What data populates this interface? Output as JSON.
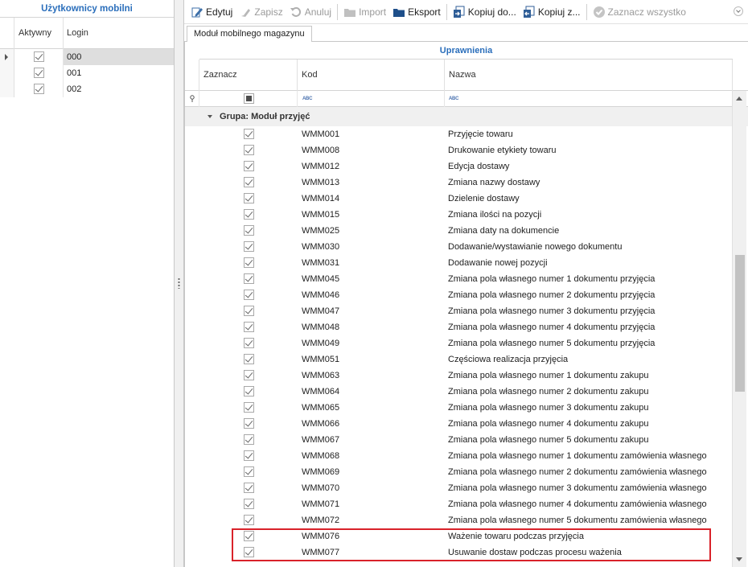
{
  "left_panel": {
    "title": "Użytkownicy mobilni",
    "columns": {
      "active": "Aktywny",
      "login": "Login"
    },
    "rows": [
      {
        "active": true,
        "login": "000",
        "selected": true
      },
      {
        "active": true,
        "login": "001",
        "selected": false
      },
      {
        "active": true,
        "login": "002",
        "selected": false
      }
    ]
  },
  "toolbar": {
    "edit": "Edytuj",
    "save": "Zapisz",
    "cancel": "Anuluj",
    "import": "Import",
    "export": "Eksport",
    "copy_to": "Kopiuj do...",
    "copy_from": "Kopiuj z...",
    "select_all": "Zaznacz wszystko"
  },
  "tab": {
    "label": "Moduł mobilnego magazynu"
  },
  "grid": {
    "band_title": "Uprawnienia",
    "columns": {
      "select": "Zaznacz",
      "code": "Kod",
      "name": "Nazwa"
    },
    "group_label": "Grupa: Moduł przyjęć",
    "rows": [
      {
        "checked": true,
        "code": "WMM001",
        "name": "Przyjęcie towaru"
      },
      {
        "checked": true,
        "code": "WMM008",
        "name": "Drukowanie etykiety towaru"
      },
      {
        "checked": true,
        "code": "WMM012",
        "name": "Edycja dostawy"
      },
      {
        "checked": true,
        "code": "WMM013",
        "name": "Zmiana nazwy dostawy"
      },
      {
        "checked": true,
        "code": "WMM014",
        "name": "Dzielenie dostawy"
      },
      {
        "checked": true,
        "code": "WMM015",
        "name": "Zmiana ilości na pozycji"
      },
      {
        "checked": true,
        "code": "WMM025",
        "name": "Zmiana daty na dokumencie"
      },
      {
        "checked": true,
        "code": "WMM030",
        "name": "Dodawanie/wystawianie nowego dokumentu"
      },
      {
        "checked": true,
        "code": "WMM031",
        "name": "Dodawanie nowej pozycji"
      },
      {
        "checked": true,
        "code": "WMM045",
        "name": "Zmiana pola własnego numer 1 dokumentu przyjęcia"
      },
      {
        "checked": true,
        "code": "WMM046",
        "name": "Zmiana pola własnego numer 2 dokumentu przyjęcia"
      },
      {
        "checked": true,
        "code": "WMM047",
        "name": "Zmiana pola własnego numer 3 dokumentu przyjęcia"
      },
      {
        "checked": true,
        "code": "WMM048",
        "name": "Zmiana pola własnego numer 4 dokumentu przyjęcia"
      },
      {
        "checked": true,
        "code": "WMM049",
        "name": "Zmiana pola własnego numer 5 dokumentu przyjęcia"
      },
      {
        "checked": true,
        "code": "WMM051",
        "name": "Częściowa realizacja przyjęcia"
      },
      {
        "checked": true,
        "code": "WMM063",
        "name": "Zmiana pola własnego numer 1 dokumentu zakupu"
      },
      {
        "checked": true,
        "code": "WMM064",
        "name": "Zmiana pola własnego numer 2 dokumentu zakupu"
      },
      {
        "checked": true,
        "code": "WMM065",
        "name": "Zmiana pola własnego numer 3 dokumentu zakupu"
      },
      {
        "checked": true,
        "code": "WMM066",
        "name": "Zmiana pola własnego numer 4 dokumentu zakupu"
      },
      {
        "checked": true,
        "code": "WMM067",
        "name": "Zmiana pola własnego numer 5 dokumentu zakupu"
      },
      {
        "checked": true,
        "code": "WMM068",
        "name": "Zmiana pola własnego numer 1 dokumentu zamówienia własnego"
      },
      {
        "checked": true,
        "code": "WMM069",
        "name": "Zmiana pola własnego numer 2 dokumentu zamówienia własnego"
      },
      {
        "checked": true,
        "code": "WMM070",
        "name": "Zmiana pola własnego numer 3 dokumentu zamówienia własnego"
      },
      {
        "checked": true,
        "code": "WMM071",
        "name": "Zmiana pola własnego numer 4 dokumentu zamówienia własnego"
      },
      {
        "checked": true,
        "code": "WMM072",
        "name": "Zmiana pola własnego numer 5 dokumentu zamówienia własnego"
      },
      {
        "checked": true,
        "code": "WMM076",
        "name": "Ważenie towaru podczas przyjęcia"
      },
      {
        "checked": true,
        "code": "WMM077",
        "name": "Usuwanie dostaw podczas procesu ważenia"
      }
    ]
  },
  "colors": {
    "accent": "#2a6ebb",
    "highlight": "#d9222a",
    "selected_row": "#dedede",
    "group_bg": "#f0f0f0"
  }
}
